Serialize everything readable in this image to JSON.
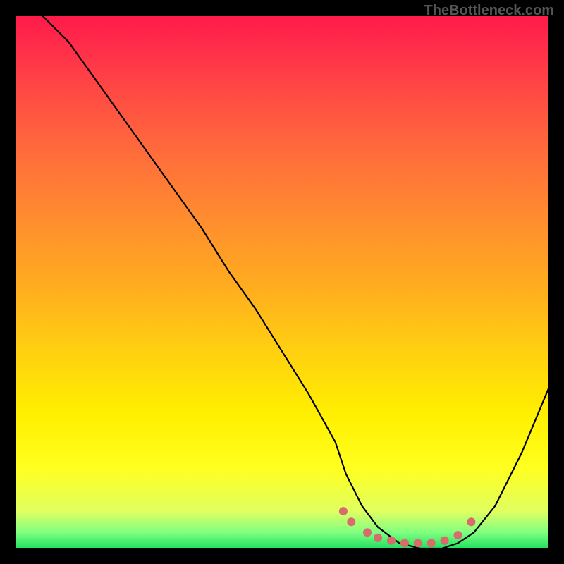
{
  "watermark": "TheBottleneck.com",
  "chart_data": {
    "type": "line",
    "title": "",
    "xlabel": "",
    "ylabel": "",
    "xlim": [
      0,
      100
    ],
    "ylim": [
      0,
      100
    ],
    "series": [
      {
        "name": "bottleneck-curve",
        "x": [
          5,
          10,
          15,
          20,
          25,
          30,
          35,
          40,
          45,
          50,
          55,
          60,
          62,
          65,
          68,
          72,
          76,
          80,
          83,
          86,
          90,
          95,
          100
        ],
        "y": [
          100,
          95,
          88,
          81,
          74,
          67,
          60,
          52,
          45,
          37,
          29,
          20,
          14,
          8,
          4,
          1,
          0,
          0,
          1,
          3,
          8,
          18,
          30
        ]
      }
    ],
    "markers": {
      "name": "highlight-dots",
      "color": "#d86b6b",
      "x": [
        61.5,
        63,
        66,
        68,
        70.5,
        73,
        75.5,
        78,
        80.5,
        83,
        85.5
      ],
      "y": [
        7,
        5,
        3,
        2,
        1.5,
        1,
        1,
        1,
        1.5,
        2.5,
        5
      ]
    },
    "gradient_stops": [
      {
        "pos": 0,
        "color": "#ff1a4a"
      },
      {
        "pos": 25,
        "color": "#ff6a3c"
      },
      {
        "pos": 50,
        "color": "#ffaa20"
      },
      {
        "pos": 75,
        "color": "#fff000"
      },
      {
        "pos": 93,
        "color": "#e0ff60"
      },
      {
        "pos": 100,
        "color": "#20e060"
      }
    ]
  }
}
